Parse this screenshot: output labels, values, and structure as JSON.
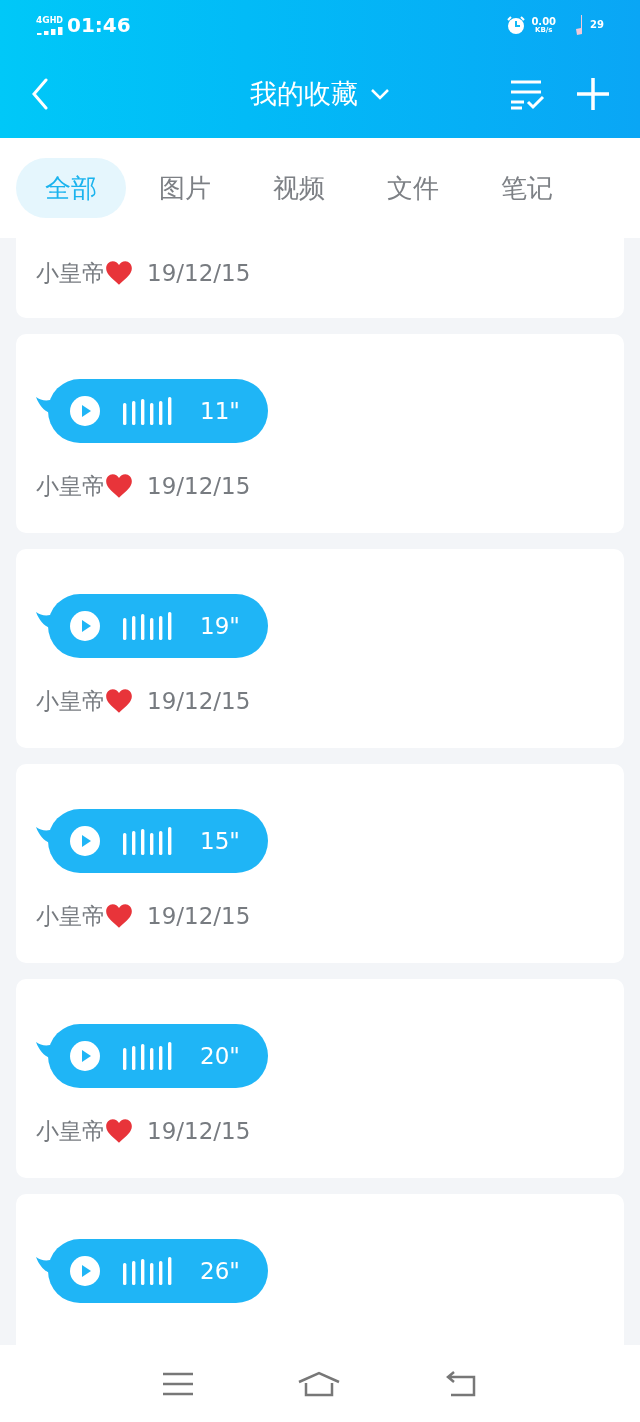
{
  "status_bar": {
    "network": "4G",
    "network_badge": "HD",
    "time": "01:46",
    "speed": "0.00",
    "speed_unit": "KB/s",
    "battery": "29"
  },
  "header": {
    "title": "我的收藏"
  },
  "tabs": [
    {
      "label": "全部",
      "selected": true
    },
    {
      "label": "图片",
      "selected": false
    },
    {
      "label": "视频",
      "selected": false
    },
    {
      "label": "文件",
      "selected": false
    },
    {
      "label": "笔记",
      "selected": false
    }
  ],
  "items": [
    {
      "author": "小皇帝",
      "date": "19/12/15"
    },
    {
      "duration": "11\"",
      "author": "小皇帝",
      "date": "19/12/15"
    },
    {
      "duration": "19\"",
      "author": "小皇帝",
      "date": "19/12/15"
    },
    {
      "duration": "15\"",
      "author": "小皇帝",
      "date": "19/12/15"
    },
    {
      "duration": "20\"",
      "author": "小皇帝",
      "date": "19/12/15"
    },
    {
      "duration": "26\""
    }
  ]
}
